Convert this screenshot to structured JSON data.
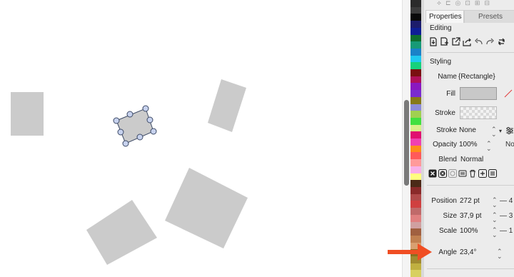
{
  "panel": {
    "tabs": [
      {
        "label": "Properties"
      },
      {
        "label": "Presets"
      }
    ],
    "editing_title": "Editing",
    "styling_title": "Styling",
    "name_label": "Name",
    "name_value": "{Rectangle}",
    "fill_label": "Fill",
    "stroke_label": "Stroke",
    "stroke_style_label": "Stroke",
    "stroke_style_value": "None",
    "stroke_style_right": "No",
    "opacity_label": "Opacity",
    "opacity_value": "100%",
    "blend_label": "Blend",
    "blend_value": "Normal",
    "position_label": "Position",
    "position_value": "272 pt",
    "position_right": "— 4",
    "size_label": "Size",
    "size_value": "37,9 pt",
    "size_right": "— 3",
    "scale_label": "Scale",
    "scale_value": "100%",
    "scale_right": "— 1",
    "angle_label": "Angle",
    "angle_value": "23,4°"
  },
  "palette": [
    "#2b2b2b",
    "#3c3c3c",
    "#0a0a0a",
    "#1c1c6c",
    "#0e1e96",
    "#0e6e2e",
    "#179a76",
    "#1a82c8",
    "#1fc8f0",
    "#16d17c",
    "#7a1010",
    "#b0105a",
    "#8a18c0",
    "#7a2bd0",
    "#877a18",
    "#8c8cd8",
    "#a0d050",
    "#40e040",
    "#d8f08a",
    "#e01070",
    "#f040b0",
    "#ff8c1a",
    "#ff5a5a",
    "#ff9a9a",
    "#f8b0e8",
    "#ffff80",
    "#4b2a18",
    "#8a2a2a",
    "#b04a4a",
    "#d04040",
    "#c06a6a",
    "#e08080",
    "#d0a0a0",
    "#a06040",
    "#c08050",
    "#d8a070",
    "#8a7020",
    "#a08a30",
    "#c0b040",
    "#d8d060"
  ],
  "colors": {
    "accent_arrow": "#f04e23",
    "shape_fill": "#cbcbcb"
  },
  "icons": [
    "export-icon",
    "duplicate-icon",
    "open-external-icon",
    "share-icon",
    "undo-icon",
    "redo-icon",
    "refresh-icon",
    "delete-icon",
    "close-box-icon",
    "style-icon",
    "library-icon",
    "trash-icon",
    "add-icon",
    "list-icon"
  ]
}
